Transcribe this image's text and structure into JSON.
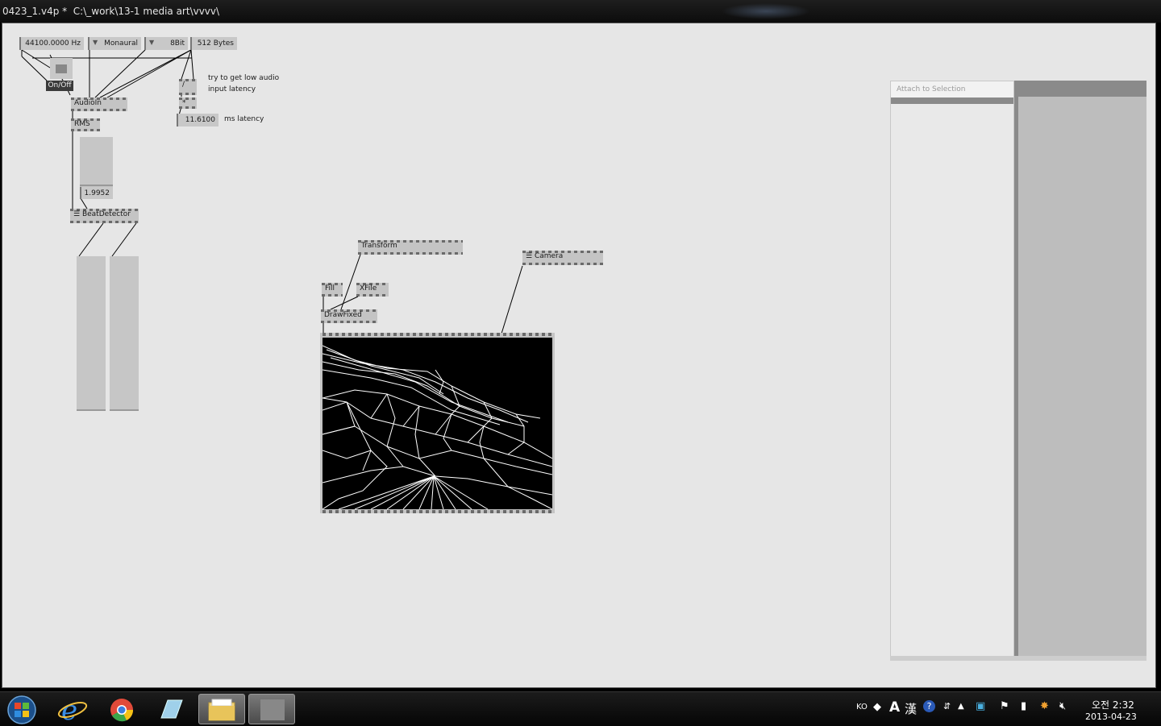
{
  "window": {
    "title": "0423_1.v4p *  C:\\_work\\13-1 media art\\vvvv\\"
  },
  "patch": {
    "samplerate": "44100.0000 Hz",
    "channels": "Monaural",
    "bitdepth": "8Bit",
    "buffer": "512 Bytes",
    "toggle_label": "On/Off",
    "audioin": "AudioIn",
    "rms": "RMS",
    "rms_value": "1.9952",
    "beatdetector": "BeatDetector",
    "multiply": "*",
    "latency_value": "11.6100",
    "comment_latency_line1": "try to get low audio",
    "comment_latency_line2": "input latency",
    "comment_ms": "ms latency",
    "transform": "Transform",
    "camera": "Camera",
    "fill": "Fill",
    "xfile": "XFile",
    "drawfixed": "DrawFixed"
  },
  "inspector": {
    "header": "Attach to Selection"
  },
  "taskbar": {
    "lang": "KO",
    "ime_a": "A",
    "ime_han": "漢",
    "time": "오전 2:32",
    "date": "2013-04-23",
    "apps": [
      "start-orb",
      "internet-explorer",
      "chrome",
      "notepad-app",
      "file-explorer",
      "vvvv-window"
    ]
  },
  "colors": {
    "canvas": "#e6e6e6",
    "node": "#c4c4c4",
    "renderer_bg": "#000000",
    "wire": "#000000"
  }
}
